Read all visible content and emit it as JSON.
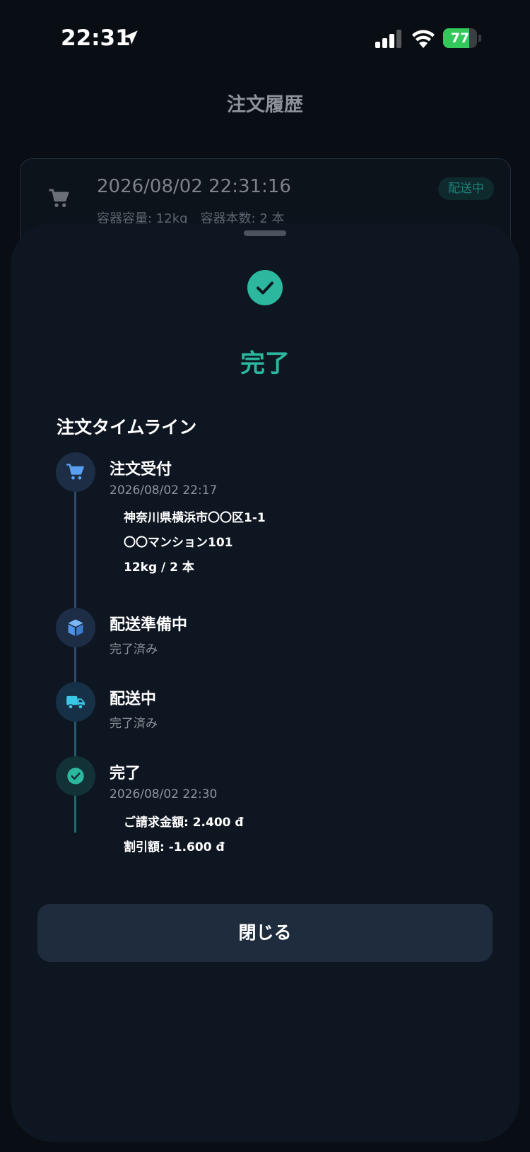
{
  "status_bar": {
    "time": "22:31",
    "battery": "77",
    "battery_level": 0.77,
    "icons": [
      "location-arrow-icon",
      "cellular-signal-icon",
      "wifi-icon",
      "battery-charging-icon"
    ]
  },
  "header": {
    "title": "注文履歴"
  },
  "order_card": {
    "icon": "cart-icon",
    "date": "2026/08/02 22:31:16",
    "meta": "容器容量: 12kg　容器本数: 2 本",
    "badge": "配送中"
  },
  "sheet": {
    "status_icon": "check-circle-icon",
    "status_title": "完了",
    "timeline_heading": "注文タイムライン",
    "timeline": [
      {
        "icon": "cart-icon",
        "title": "注文受付",
        "subtitle": "2026/08/02 22:17",
        "details": [
          "神奈川県横浜市〇〇区1-1",
          "〇〇マンション101",
          "12kg / 2 本"
        ]
      },
      {
        "icon": "box-icon",
        "title": "配送準備中",
        "subtitle": "完了済み"
      },
      {
        "icon": "truck-icon",
        "title": "配送中",
        "subtitle": "完了済み"
      },
      {
        "icon": "check-circle-icon",
        "title": "完了",
        "subtitle": "2026/08/02 22:30",
        "details": [
          "ご請求金額: 2.400 đ",
          "割引額: -1.600 đ"
        ]
      }
    ],
    "close_label": "閉じる"
  },
  "colors": {
    "background": "#090d14",
    "sheet": "#0e1621",
    "accent_teal": "#2cb89f",
    "node_blue": "#1d2d45",
    "node_teal": "#133237",
    "button": "#1f2c3e"
  }
}
